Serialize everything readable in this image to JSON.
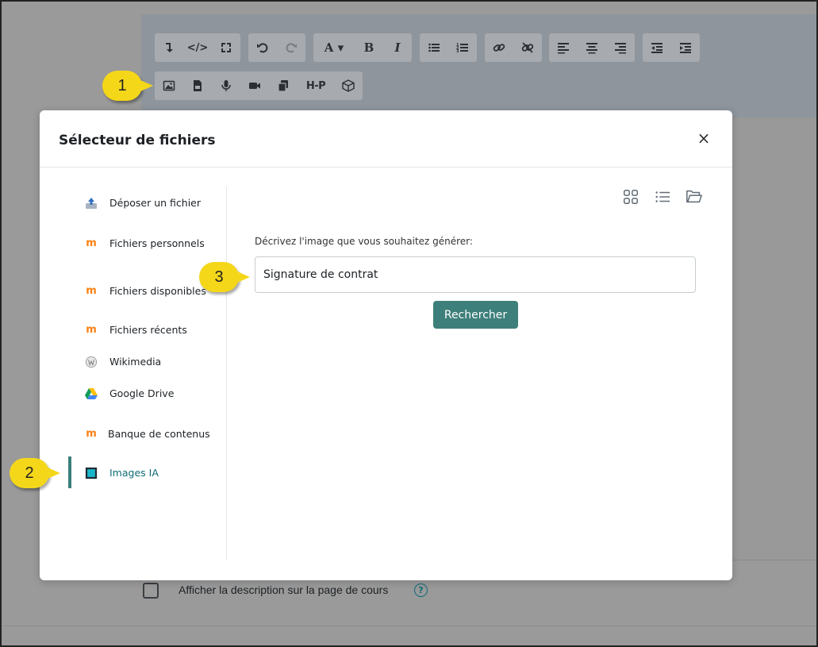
{
  "toolbar": {
    "row1": [
      [
        "insert-icon",
        "</>",
        "fullscreen-icon"
      ],
      [
        "undo-icon",
        "redo-icon"
      ],
      [
        "A ▾",
        "B",
        "I"
      ],
      [
        "unordered-list-icon",
        "ordered-list-icon"
      ],
      [
        "link-icon",
        "unlink-icon"
      ],
      [
        "align-left-icon",
        "align-center-icon",
        "align-right-icon"
      ],
      [
        "outdent-icon",
        "indent-icon"
      ]
    ],
    "h5p_label": "H-P"
  },
  "modal": {
    "title": "Sélecteur de fichiers",
    "close_label": "×"
  },
  "sidebar": {
    "items": [
      {
        "label": "Déposer un fichier",
        "icon": "upload-icon"
      },
      {
        "label": "Fichiers personnels",
        "icon": "moodle-icon"
      },
      {
        "label": "Fichiers disponibles",
        "icon": "moodle-icon"
      },
      {
        "label": "Fichiers récents",
        "icon": "moodle-icon"
      },
      {
        "label": "Wikimedia",
        "icon": "wikimedia-icon"
      },
      {
        "label": "Google Drive",
        "icon": "google-drive-icon"
      },
      {
        "label": "Banque de contenus",
        "icon": "moodle-icon"
      },
      {
        "label": "Images IA",
        "icon": "ai-image-icon",
        "active": true
      }
    ]
  },
  "main": {
    "prompt_label": "Décrivez l'image que vous souhaitez générer:",
    "prompt_value": "Signature de contrat",
    "search_label": "Rechercher"
  },
  "footer": {
    "checkbox_label": "Afficher la description sur la page de cours",
    "help_symbol": "?"
  },
  "callouts": [
    "1",
    "2",
    "3"
  ],
  "colors": {
    "accent": "#3d7f7a",
    "callout": "#f5d71a",
    "overlay": "#999999"
  }
}
